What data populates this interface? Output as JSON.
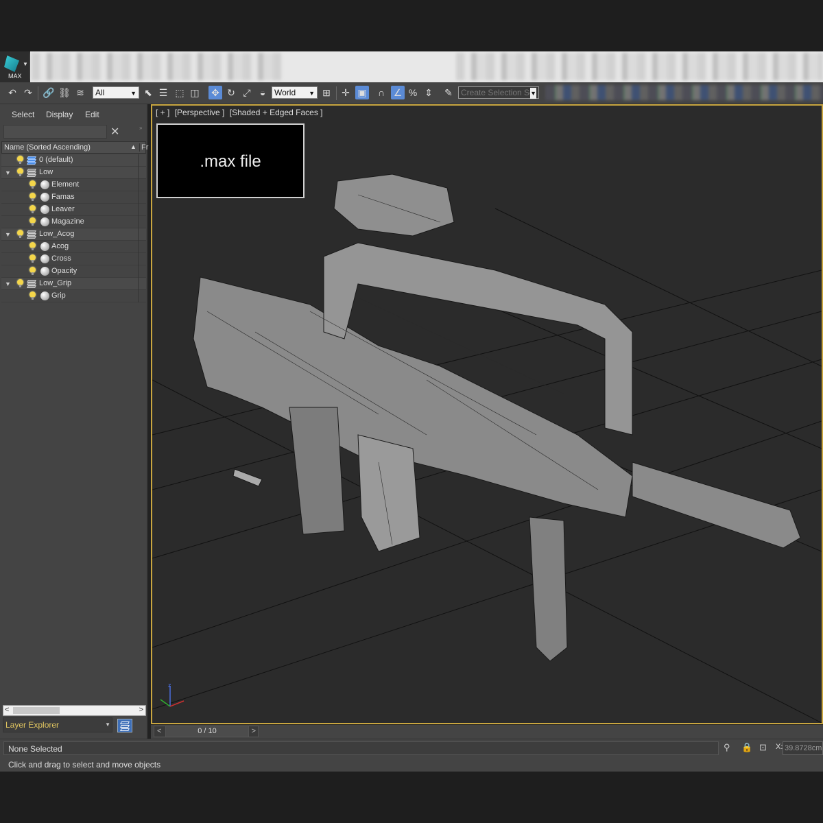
{
  "titlebar": {
    "logo_label": "MAX"
  },
  "toolbar": {
    "filter_value": "All",
    "coord_value": "World",
    "selection_set_placeholder": "Create Selection Se"
  },
  "explorer": {
    "menu": [
      "Select",
      "Display",
      "Edit"
    ],
    "column_header": "Name (Sorted Ascending)",
    "column_frozen": "Fr",
    "rows": [
      {
        "label": "0 (default)",
        "kind": "layer",
        "level": 0,
        "blue": true
      },
      {
        "label": "Low",
        "kind": "layer",
        "level": 0,
        "expanded": true
      },
      {
        "label": "Element",
        "kind": "object",
        "level": 1
      },
      {
        "label": "Famas",
        "kind": "object",
        "level": 1
      },
      {
        "label": "Leaver",
        "kind": "object",
        "level": 1
      },
      {
        "label": "Magazine",
        "kind": "object",
        "level": 1
      },
      {
        "label": "Low_Acog",
        "kind": "layer",
        "level": 0,
        "expanded": true
      },
      {
        "label": "Acog",
        "kind": "object",
        "level": 1
      },
      {
        "label": "Cross",
        "kind": "object",
        "level": 1
      },
      {
        "label": "Opacity",
        "kind": "object",
        "level": 1
      },
      {
        "label": "Low_Grip",
        "kind": "layer",
        "level": 0,
        "expanded": true
      },
      {
        "label": "Grip",
        "kind": "object",
        "level": 1
      }
    ],
    "layer_explorer_label": "Layer Explorer"
  },
  "viewport": {
    "labels": [
      "[ + ]",
      "[Perspective ]",
      "[Shaded + Edged Faces ]"
    ],
    "overlay_text": ".max file",
    "axis": {
      "z": "z"
    }
  },
  "timeline": {
    "frame": "0 / 10",
    "prev": "<",
    "next": ">"
  },
  "status": {
    "selection": "None Selected",
    "hint": "Click and drag to select and move objects",
    "x_label": "X:",
    "x_value": "39.8728cm"
  },
  "colors": {
    "viewport_border": "#c9a640",
    "layer_label": "#e0c560",
    "active_tool": "#5b8bd6"
  }
}
